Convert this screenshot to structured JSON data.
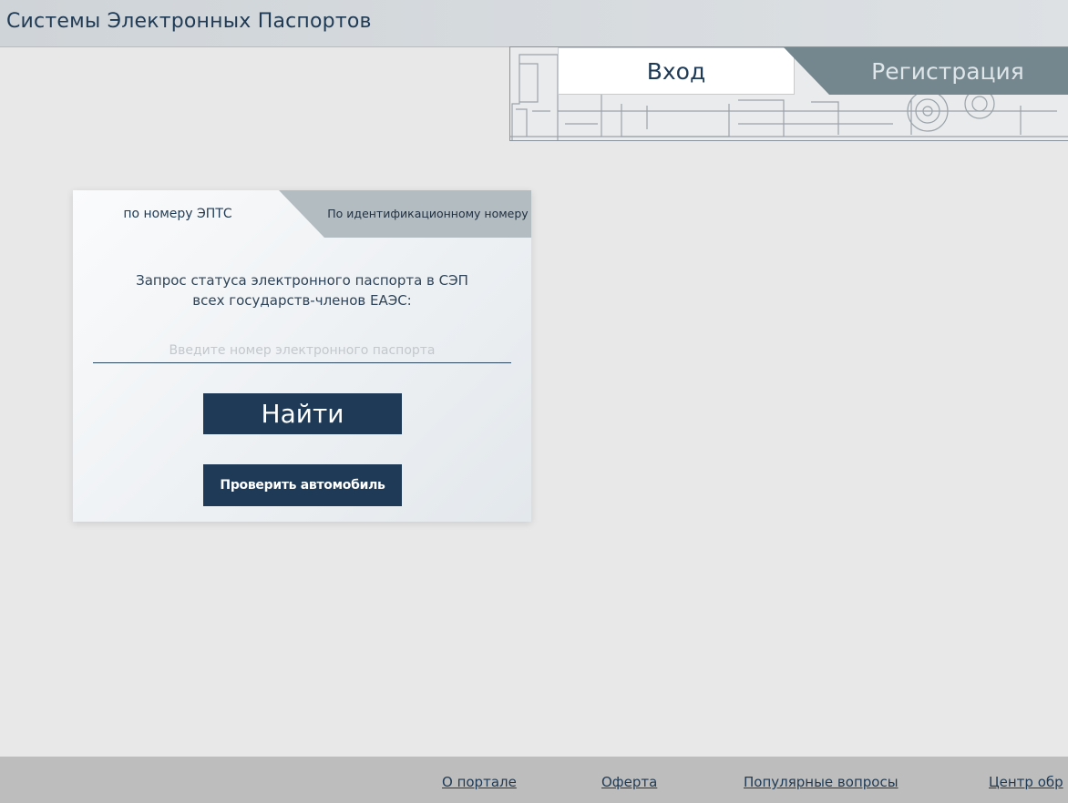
{
  "header": {
    "title": "Системы Электронных Паспортов"
  },
  "auth_tabs": {
    "login": "Вход",
    "register": "Регистрация"
  },
  "search_card": {
    "tab_active": "по номеру ЭПТС",
    "tab_inactive": "По идентификационному номеру",
    "description_line1": "Запрос статуса электронного паспорта в СЭП",
    "description_line2": "всех государств-членов ЕАЭС:",
    "input_value": "",
    "input_placeholder": "Введите номер электронного паспорта",
    "find_button": "Найти",
    "check_car_button": "Проверить автомобиль"
  },
  "footer": {
    "links": [
      "О портале",
      "Оферта",
      "Популярные вопросы",
      "Центр обр"
    ]
  },
  "colors": {
    "accent": "#1e3a57",
    "background": "#e8e8e8",
    "header": "#d3d8dc",
    "register_tab": "#74878f",
    "footer": "#bdbdbd"
  }
}
